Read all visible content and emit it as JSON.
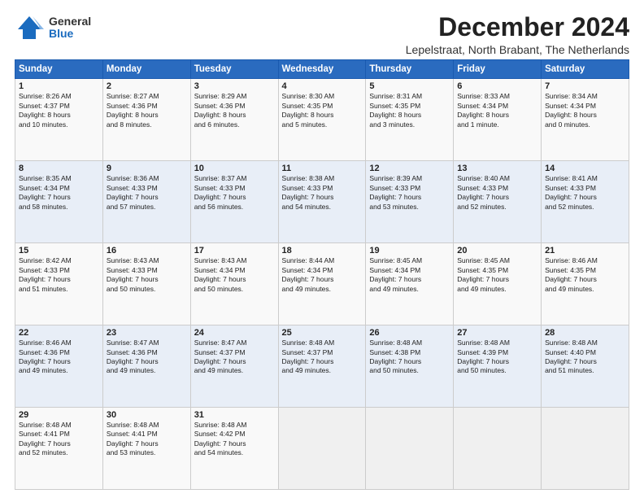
{
  "logo": {
    "general": "General",
    "blue": "Blue"
  },
  "title": "December 2024",
  "subtitle": "Lepelstraat, North Brabant, The Netherlands",
  "days_header": [
    "Sunday",
    "Monday",
    "Tuesday",
    "Wednesday",
    "Thursday",
    "Friday",
    "Saturday"
  ],
  "weeks": [
    [
      {
        "day": "1",
        "info": "Sunrise: 8:26 AM\nSunset: 4:37 PM\nDaylight: 8 hours\nand 10 minutes."
      },
      {
        "day": "2",
        "info": "Sunrise: 8:27 AM\nSunset: 4:36 PM\nDaylight: 8 hours\nand 8 minutes."
      },
      {
        "day": "3",
        "info": "Sunrise: 8:29 AM\nSunset: 4:36 PM\nDaylight: 8 hours\nand 6 minutes."
      },
      {
        "day": "4",
        "info": "Sunrise: 8:30 AM\nSunset: 4:35 PM\nDaylight: 8 hours\nand 5 minutes."
      },
      {
        "day": "5",
        "info": "Sunrise: 8:31 AM\nSunset: 4:35 PM\nDaylight: 8 hours\nand 3 minutes."
      },
      {
        "day": "6",
        "info": "Sunrise: 8:33 AM\nSunset: 4:34 PM\nDaylight: 8 hours\nand 1 minute."
      },
      {
        "day": "7",
        "info": "Sunrise: 8:34 AM\nSunset: 4:34 PM\nDaylight: 8 hours\nand 0 minutes."
      }
    ],
    [
      {
        "day": "8",
        "info": "Sunrise: 8:35 AM\nSunset: 4:34 PM\nDaylight: 7 hours\nand 58 minutes."
      },
      {
        "day": "9",
        "info": "Sunrise: 8:36 AM\nSunset: 4:33 PM\nDaylight: 7 hours\nand 57 minutes."
      },
      {
        "day": "10",
        "info": "Sunrise: 8:37 AM\nSunset: 4:33 PM\nDaylight: 7 hours\nand 56 minutes."
      },
      {
        "day": "11",
        "info": "Sunrise: 8:38 AM\nSunset: 4:33 PM\nDaylight: 7 hours\nand 54 minutes."
      },
      {
        "day": "12",
        "info": "Sunrise: 8:39 AM\nSunset: 4:33 PM\nDaylight: 7 hours\nand 53 minutes."
      },
      {
        "day": "13",
        "info": "Sunrise: 8:40 AM\nSunset: 4:33 PM\nDaylight: 7 hours\nand 52 minutes."
      },
      {
        "day": "14",
        "info": "Sunrise: 8:41 AM\nSunset: 4:33 PM\nDaylight: 7 hours\nand 52 minutes."
      }
    ],
    [
      {
        "day": "15",
        "info": "Sunrise: 8:42 AM\nSunset: 4:33 PM\nDaylight: 7 hours\nand 51 minutes."
      },
      {
        "day": "16",
        "info": "Sunrise: 8:43 AM\nSunset: 4:33 PM\nDaylight: 7 hours\nand 50 minutes."
      },
      {
        "day": "17",
        "info": "Sunrise: 8:43 AM\nSunset: 4:34 PM\nDaylight: 7 hours\nand 50 minutes."
      },
      {
        "day": "18",
        "info": "Sunrise: 8:44 AM\nSunset: 4:34 PM\nDaylight: 7 hours\nand 49 minutes."
      },
      {
        "day": "19",
        "info": "Sunrise: 8:45 AM\nSunset: 4:34 PM\nDaylight: 7 hours\nand 49 minutes."
      },
      {
        "day": "20",
        "info": "Sunrise: 8:45 AM\nSunset: 4:35 PM\nDaylight: 7 hours\nand 49 minutes."
      },
      {
        "day": "21",
        "info": "Sunrise: 8:46 AM\nSunset: 4:35 PM\nDaylight: 7 hours\nand 49 minutes."
      }
    ],
    [
      {
        "day": "22",
        "info": "Sunrise: 8:46 AM\nSunset: 4:36 PM\nDaylight: 7 hours\nand 49 minutes."
      },
      {
        "day": "23",
        "info": "Sunrise: 8:47 AM\nSunset: 4:36 PM\nDaylight: 7 hours\nand 49 minutes."
      },
      {
        "day": "24",
        "info": "Sunrise: 8:47 AM\nSunset: 4:37 PM\nDaylight: 7 hours\nand 49 minutes."
      },
      {
        "day": "25",
        "info": "Sunrise: 8:48 AM\nSunset: 4:37 PM\nDaylight: 7 hours\nand 49 minutes."
      },
      {
        "day": "26",
        "info": "Sunrise: 8:48 AM\nSunset: 4:38 PM\nDaylight: 7 hours\nand 50 minutes."
      },
      {
        "day": "27",
        "info": "Sunrise: 8:48 AM\nSunset: 4:39 PM\nDaylight: 7 hours\nand 50 minutes."
      },
      {
        "day": "28",
        "info": "Sunrise: 8:48 AM\nSunset: 4:40 PM\nDaylight: 7 hours\nand 51 minutes."
      }
    ],
    [
      {
        "day": "29",
        "info": "Sunrise: 8:48 AM\nSunset: 4:41 PM\nDaylight: 7 hours\nand 52 minutes."
      },
      {
        "day": "30",
        "info": "Sunrise: 8:48 AM\nSunset: 4:41 PM\nDaylight: 7 hours\nand 53 minutes."
      },
      {
        "day": "31",
        "info": "Sunrise: 8:48 AM\nSunset: 4:42 PM\nDaylight: 7 hours\nand 54 minutes."
      },
      {
        "day": "",
        "info": ""
      },
      {
        "day": "",
        "info": ""
      },
      {
        "day": "",
        "info": ""
      },
      {
        "day": "",
        "info": ""
      }
    ]
  ]
}
